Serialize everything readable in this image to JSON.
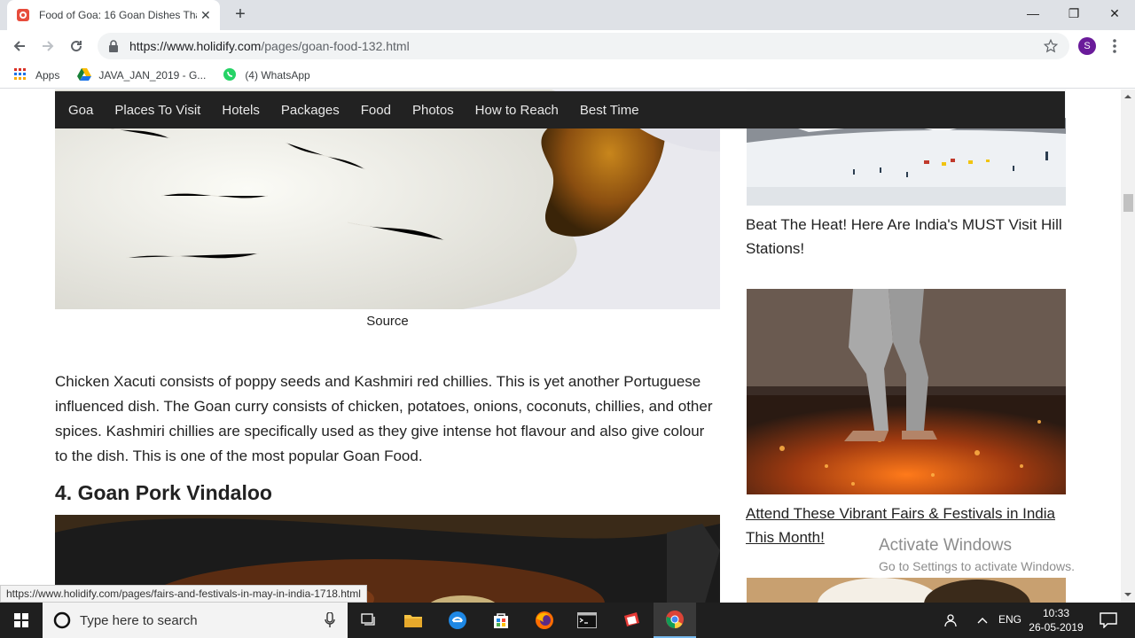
{
  "browser": {
    "tab": {
      "title": "Food of Goa: 16 Goan Dishes Tha",
      "close_label": "✕"
    },
    "new_tab_label": "+",
    "window_controls": {
      "minimize": "—",
      "restore": "❐",
      "close": "✕"
    },
    "url": {
      "host": "https://www.holidify.com",
      "path": "/pages/goan-food-132.html"
    },
    "avatar_letter": "S",
    "bookmarks": [
      {
        "label": "Apps",
        "icon": "apps-grid-icon"
      },
      {
        "label": "JAVA_JAN_2019 - G...",
        "icon": "google-drive-icon"
      },
      {
        "label": "(4) WhatsApp",
        "icon": "whatsapp-icon"
      }
    ]
  },
  "site_nav": {
    "items": [
      "Goa",
      "Places To Visit",
      "Hotels",
      "Packages",
      "Food",
      "Photos",
      "How to Reach",
      "Best Time"
    ]
  },
  "article": {
    "caption": "Source",
    "paragraph": "Chicken Xacuti consists of poppy seeds and Kashmiri red chillies. This is yet another Portuguese influenced dish. The Goan curry consists of chicken, potatoes, onions, coconuts, chillies, and other spices. Kashmiri chillies are specifically used as they give intense hot flavour and also give colour to the dish. This is one of the most popular Goan Food.",
    "heading": "4. Goan Pork Vindaloo"
  },
  "sidebar": {
    "link1": "Beat The Heat! Here Are India's MUST Visit Hill Stations!",
    "link2": "Attend These Vibrant Fairs & Festivals in India This Month!"
  },
  "watermark": {
    "line1": "Activate Windows",
    "line2": "Go to Settings to activate Windows."
  },
  "status_url": "https://www.holidify.com/pages/fairs-and-festivals-in-may-in-india-1718.html",
  "taskbar": {
    "search_placeholder": "Type here to search",
    "language": "ENG",
    "time": "10:33",
    "date": "26-05-2019"
  },
  "colors": {
    "site_nav_bg": "#222222",
    "taskbar_bg": "#1f1f1f",
    "chrome_accent": "#6a1b9a"
  }
}
